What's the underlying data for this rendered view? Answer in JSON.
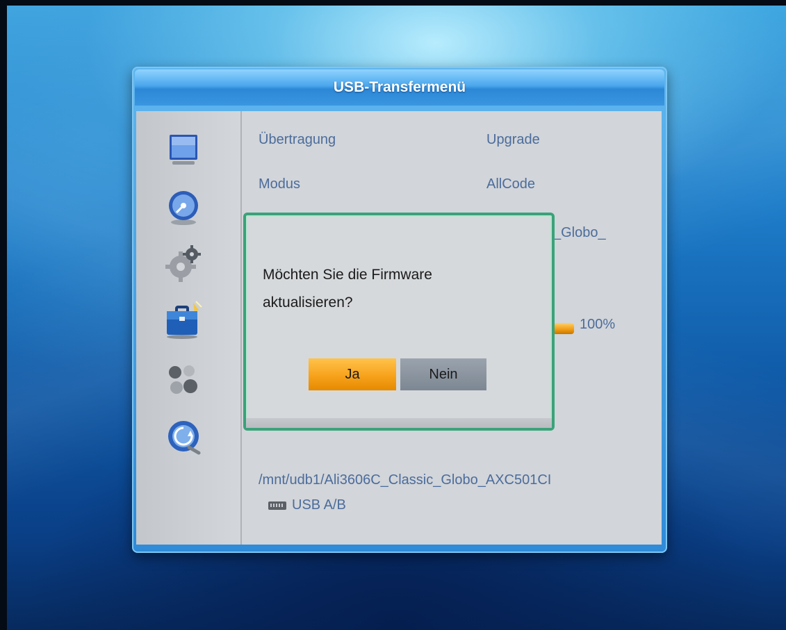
{
  "menu": {
    "title": "USB-Transfermenü",
    "sidebar": [
      {
        "icon": "tv-icon"
      },
      {
        "icon": "satellite-dish-icon"
      },
      {
        "icon": "gear-icon"
      },
      {
        "icon": "toolbox-icon"
      },
      {
        "icon": "media-icon"
      },
      {
        "icon": "network-globe-icon"
      }
    ],
    "rows": [
      {
        "label": "Übertragung",
        "value": "Upgrade"
      },
      {
        "label": "Modus",
        "value": "AllCode"
      }
    ],
    "partial_filename": "_Globo_",
    "progress": {
      "percent_text": "100%",
      "fraction": 1.0
    },
    "path": "/mnt/udb1/Ali3606C_Classic_Globo_AXC501CI",
    "device": "USB A/B"
  },
  "dialog": {
    "message_line1": "Möchten Sie die Firmware",
    "message_line2": "aktualisieren?",
    "yes_label": "Ja",
    "no_label": "Nein",
    "selected": "yes",
    "border_color": "#3aa27a",
    "selected_color": "#f7a21c"
  }
}
